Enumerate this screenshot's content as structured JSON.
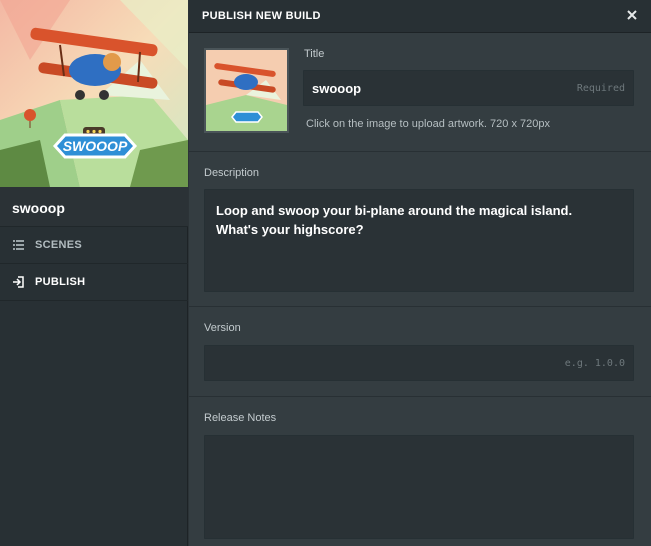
{
  "project": {
    "name": "swooop",
    "logo_text": "SWOOOP"
  },
  "sidebar": {
    "items": [
      {
        "label": "SCENES",
        "icon": "list-icon"
      },
      {
        "label": "PUBLISH",
        "icon": "publish-icon"
      }
    ]
  },
  "dialog": {
    "title": "PUBLISH NEW BUILD",
    "close_icon": "close-icon"
  },
  "form": {
    "title_label": "Title",
    "title_value": "swooop",
    "title_required": "Required",
    "artwork_hint": "Click on the image to upload artwork. 720 x 720px",
    "description_label": "Description",
    "description_value": "Loop and swoop your bi-plane around the magical island. What's your highscore?",
    "version_label": "Version",
    "version_placeholder": "e.g. 1.0.0",
    "release_notes_label": "Release Notes",
    "release_notes_value": ""
  },
  "colors": {
    "sidebar_bg": "#283034",
    "panel_bg": "#343d41",
    "field_bg": "#2a3236",
    "accent_plane": "#d9532c",
    "logo_blue": "#2e8fd6"
  }
}
